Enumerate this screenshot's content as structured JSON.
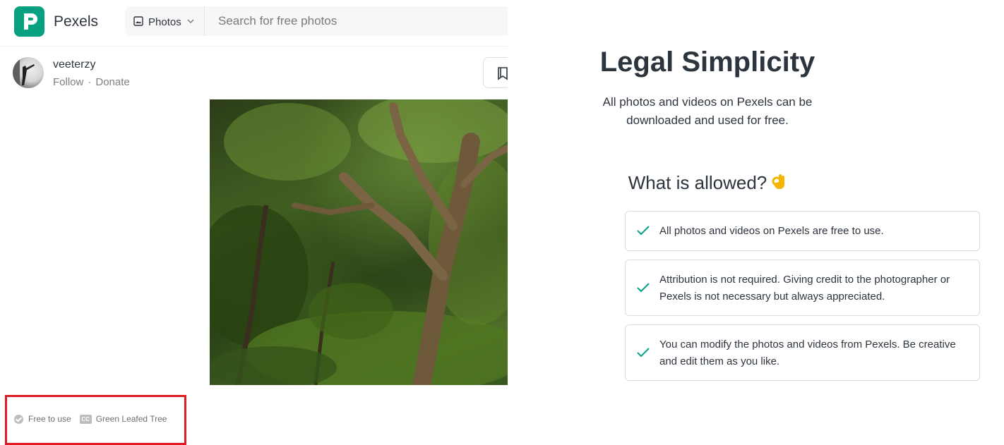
{
  "header": {
    "brand": "Pexels",
    "search_type_label": "Photos",
    "search_placeholder": "Search for free photos"
  },
  "author": {
    "username": "veeterzy",
    "follow_label": "Follow",
    "separator": "·",
    "donate_label": "Donate"
  },
  "license": {
    "free_label": "Free to use",
    "title_label": "Green Leafed Tree"
  },
  "legal": {
    "title": "Legal Simplicity",
    "subtitle_line1": "All photos and videos on Pexels can be",
    "subtitle_line2": "downloaded and used for free.",
    "allowed_title": "What is allowed?",
    "items": [
      {
        "text": "All photos and videos on Pexels are free to use."
      },
      {
        "text": "Attribution is not required. Giving credit to the photographer or Pexels is not necessary but always appreciated."
      },
      {
        "text": "You can modify the photos and videos from Pexels. Be creative and edit them as you like."
      }
    ]
  },
  "colors": {
    "brand_green": "#07a081",
    "check_green": "#05a081",
    "highlight_red": "#e01b24",
    "text_dark": "#2c343e"
  }
}
